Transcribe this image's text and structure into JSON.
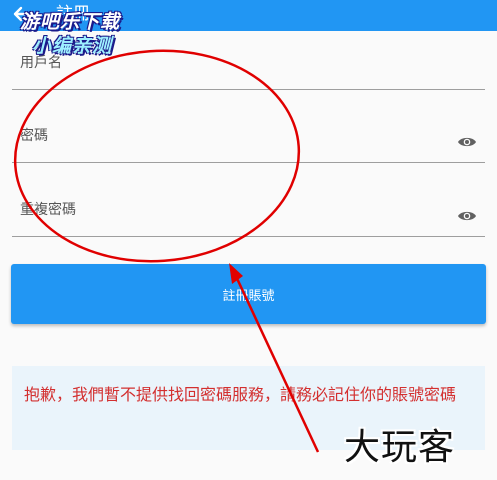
{
  "appbar": {
    "title": "註冊",
    "back_icon": "arrow-back-icon",
    "color": "#2196f3"
  },
  "form": {
    "username_label": "用戶名",
    "password_label": "密碼",
    "confirm_password_label": "重複密碼",
    "visibility_icon": "eye-icon"
  },
  "register_button": {
    "label": "註冊賬號"
  },
  "notice": {
    "text": "抱歉，我們暫不提供找回密碼服務，請務必記住你的賬號密碼",
    "color": "#d32f2f"
  },
  "watermarks": {
    "top_line1": "游吧乐下载",
    "top_line2": "小编亲测",
    "bottom": "大玩客"
  },
  "annotation_color": "#e00000"
}
